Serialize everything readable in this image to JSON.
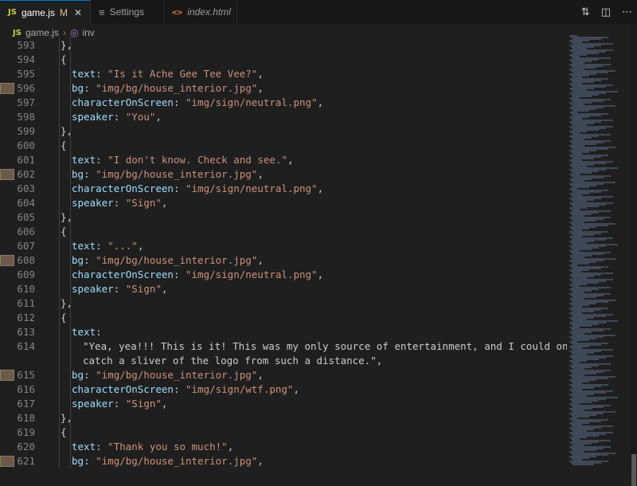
{
  "tabs": [
    {
      "label": "game.js",
      "status": "M",
      "icon": "js-icon",
      "active": true
    },
    {
      "label": "Settings",
      "icon": "settings-icon",
      "active": false
    },
    {
      "label": "index.html",
      "icon": "html-icon",
      "active": false
    }
  ],
  "breadcrumb": {
    "file": "game.js",
    "symbol": "inv"
  },
  "code_lines": [
    {
      "n": 593,
      "text": "},",
      "marker": false
    },
    {
      "n": 594,
      "text": "{",
      "marker": false
    },
    {
      "n": 595,
      "text": "text: \"Is it Ache Gee Tee Vee?\",",
      "marker": false
    },
    {
      "n": 596,
      "text": "bg: \"img/bg/house_interior.jpg\",",
      "marker": true
    },
    {
      "n": 597,
      "text": "characterOnScreen: \"img/sign/neutral.png\",",
      "marker": false
    },
    {
      "n": 598,
      "text": "speaker: \"You\",",
      "marker": false
    },
    {
      "n": 599,
      "text": "},",
      "marker": false
    },
    {
      "n": 600,
      "text": "{",
      "marker": false
    },
    {
      "n": 601,
      "text": "text: \"I don't know. Check and see.\",",
      "marker": false
    },
    {
      "n": 602,
      "text": "bg: \"img/bg/house_interior.jpg\",",
      "marker": true
    },
    {
      "n": 603,
      "text": "characterOnScreen: \"img/sign/neutral.png\",",
      "marker": false
    },
    {
      "n": 604,
      "text": "speaker: \"Sign\",",
      "marker": false
    },
    {
      "n": 605,
      "text": "},",
      "marker": false
    },
    {
      "n": 606,
      "text": "{",
      "marker": false
    },
    {
      "n": 607,
      "text": "text: \"...\",",
      "marker": false
    },
    {
      "n": 608,
      "text": "bg: \"img/bg/house_interior.jpg\",",
      "marker": true
    },
    {
      "n": 609,
      "text": "characterOnScreen: \"img/sign/neutral.png\",",
      "marker": false
    },
    {
      "n": 610,
      "text": "speaker: \"Sign\",",
      "marker": false
    },
    {
      "n": 611,
      "text": "},",
      "marker": false
    },
    {
      "n": 612,
      "text": "{",
      "marker": false
    },
    {
      "n": 613,
      "text": "text:",
      "marker": false
    },
    {
      "n": 614,
      "text": "\"Yea, yea!!! This is it! This was my only source of entertainment, and I could only",
      "marker": false
    },
    {
      "n": "",
      "text": "catch a sliver of the logo from such a distance.\",",
      "marker": false
    },
    {
      "n": 615,
      "text": "bg: \"img/bg/house_interior.jpg\",",
      "marker": true
    },
    {
      "n": 616,
      "text": "characterOnScreen: \"img/sign/wtf.png\",",
      "marker": false
    },
    {
      "n": 617,
      "text": "speaker: \"Sign\",",
      "marker": false
    },
    {
      "n": 618,
      "text": "},",
      "marker": false
    },
    {
      "n": 619,
      "text": "{",
      "marker": false
    },
    {
      "n": 620,
      "text": "text: \"Thank you so much!\",",
      "marker": false
    },
    {
      "n": 621,
      "text": "bg: \"img/bg/house_interior.jpg\",",
      "marker": true
    }
  ],
  "colors": {
    "key": "#9cdcfe",
    "string": "#ce9178",
    "accent": "#0078d4"
  }
}
